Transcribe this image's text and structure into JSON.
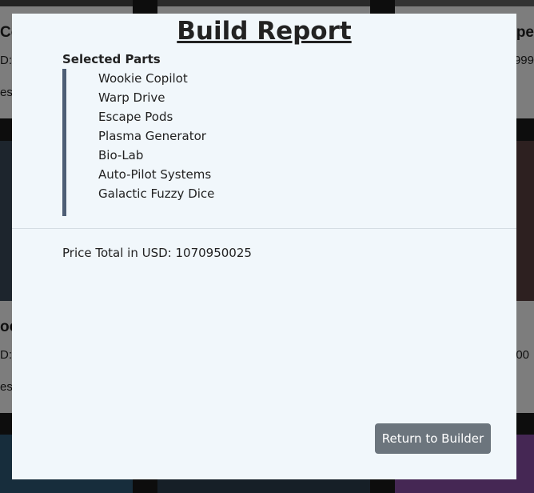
{
  "modal": {
    "title": "Build Report",
    "parts_heading": "Selected Parts",
    "parts": [
      "Wookie Copilot",
      "Warp Drive",
      "Escape Pods",
      "Plasma Generator",
      "Bio-Lab",
      "Auto-Pilot Systems",
      "Galactic Fuzzy Dice"
    ],
    "price_label": "Price Total in USD:",
    "price_value": "1070950025",
    "return_button": "Return to Builder"
  },
  "background": {
    "card_left_top_title": "Co",
    "card_left_top_price": "D:",
    "card_left_top_desc": "es",
    "card_right_top_title": "upe",
    "card_right_top_price": "999",
    "card_left_mid_title": "oo",
    "card_left_mid_price": "D:",
    "card_left_mid_desc": "es",
    "card_right_mid_price": "00"
  }
}
